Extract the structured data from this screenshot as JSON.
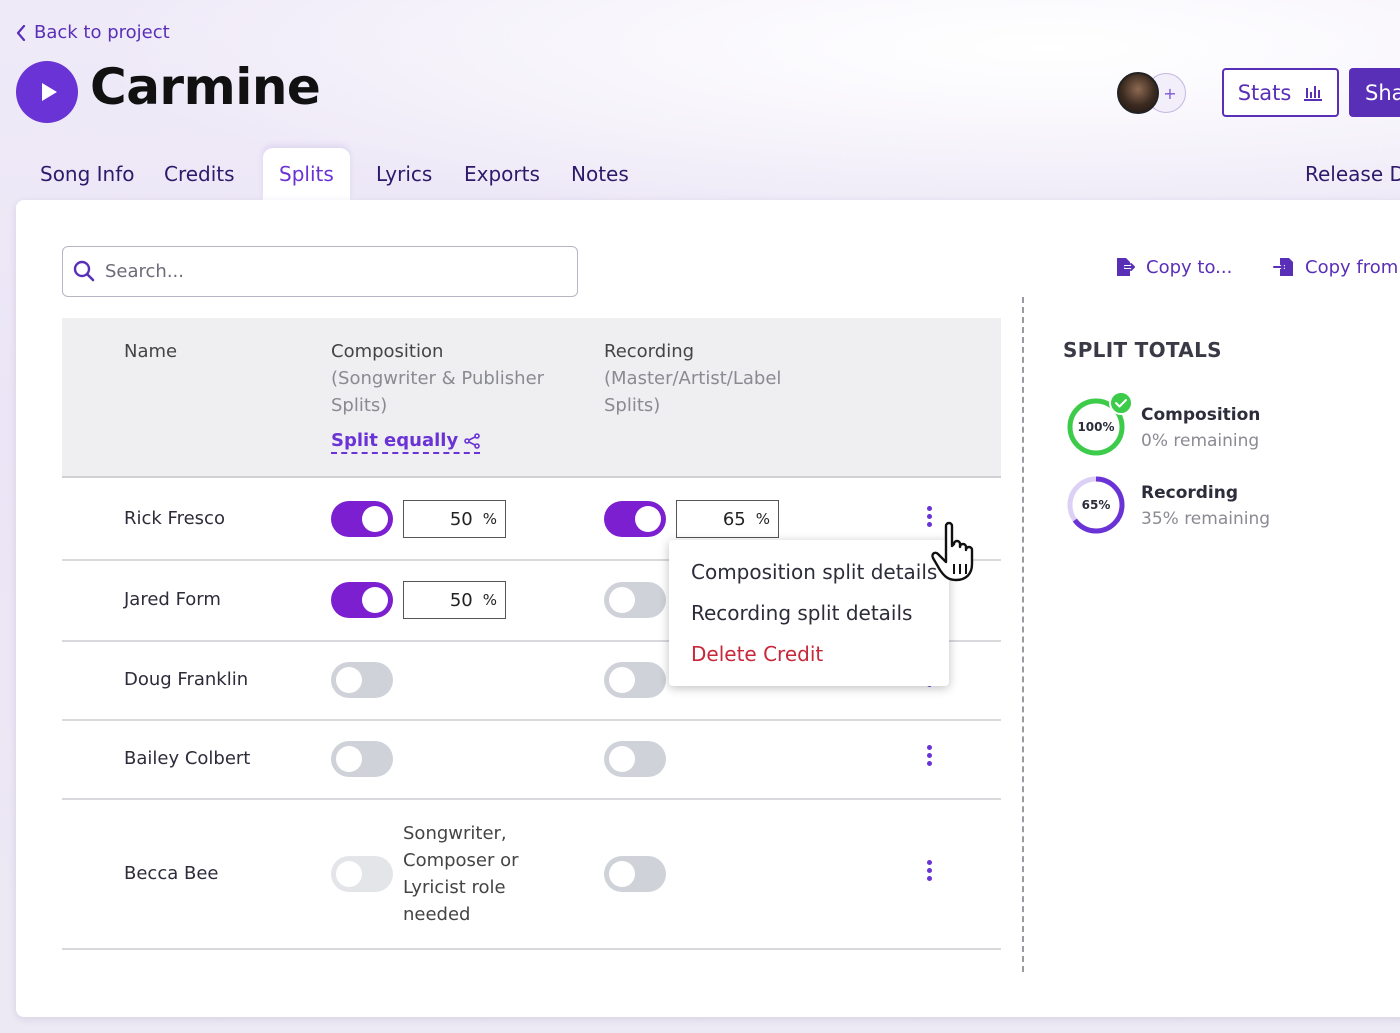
{
  "nav": {
    "back_label": "Back to project"
  },
  "header": {
    "title": "Carmine",
    "stats_label": "Stats",
    "share_label": "Share"
  },
  "tabs": [
    {
      "label": "Song Info"
    },
    {
      "label": "Credits"
    },
    {
      "label": "Splits",
      "active": true
    },
    {
      "label": "Lyrics"
    },
    {
      "label": "Exports"
    },
    {
      "label": "Notes"
    }
  ],
  "release_tab_label": "Release Date",
  "search": {
    "placeholder": "Search..."
  },
  "actions": {
    "copy_to": "Copy to...",
    "copy_from": "Copy from..."
  },
  "table": {
    "headers": {
      "name": "Name",
      "composition": "Composition",
      "composition_sub": "(Songwriter & Publisher Splits)",
      "recording": "Recording",
      "recording_sub": "(Master/Artist/Label Splits)",
      "split_equally": "Split equally"
    },
    "rows": [
      {
        "name": "Rick Fresco",
        "composition_on": true,
        "composition_pct": "50",
        "recording_on": true,
        "recording_pct": "65"
      },
      {
        "name": "Jared Form",
        "composition_on": true,
        "composition_pct": "50",
        "recording_on": false
      },
      {
        "name": "Doug Franklin",
        "composition_on": false,
        "recording_on": false
      },
      {
        "name": "Bailey Colbert",
        "composition_on": false,
        "recording_on": false
      },
      {
        "name": "Becca Bee",
        "composition_on": false,
        "composition_disabled": true,
        "role_note": "Songwriter, Composer or Lyricist role needed",
        "recording_on": false
      }
    ],
    "percent_unit": "%"
  },
  "context_menu": {
    "items": [
      {
        "label": "Composition split details"
      },
      {
        "label": "Recording split details"
      },
      {
        "label": "Delete Credit",
        "danger": true
      }
    ]
  },
  "totals": {
    "title": "SPLIT TOTALS",
    "composition": {
      "label": "Composition",
      "percent_text": "100%",
      "remaining": "0% remaining",
      "percent": 100,
      "complete": true
    },
    "recording": {
      "label": "Recording",
      "percent_text": "65%",
      "remaining": "35% remaining",
      "percent": 65
    }
  },
  "colors": {
    "accent": "#6a33d6",
    "toggle_on": "#7c1fd0",
    "complete": "#3ccc4a",
    "danger": "#c8283a"
  },
  "icons": [
    "chevron-left-icon",
    "play-icon",
    "plus-icon",
    "bar-chart-icon",
    "search-icon",
    "copy-to-icon",
    "copy-from-icon",
    "share-nodes-icon",
    "kebab-icon",
    "check-icon",
    "hand-cursor-icon"
  ]
}
